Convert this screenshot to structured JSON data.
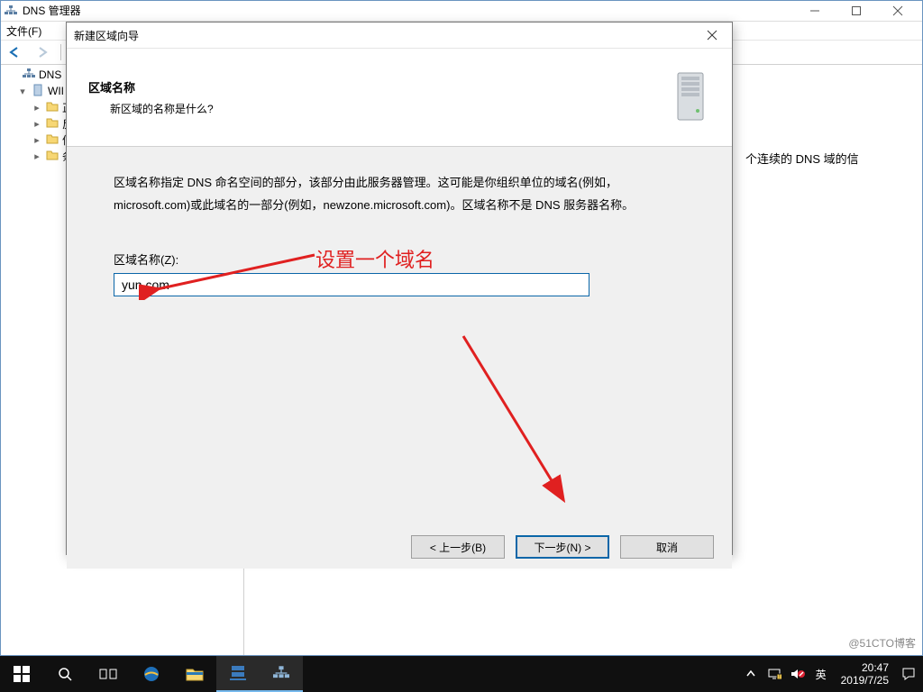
{
  "dns_window": {
    "title": "DNS 管理器",
    "menubar": {
      "file": "文件(F)"
    },
    "tree": {
      "root": "DNS",
      "server": "WII",
      "folders": [
        "正",
        "反",
        "信",
        "条"
      ]
    },
    "right_text": "个连续的 DNS 域的信"
  },
  "wizard": {
    "title": "新建区域向导",
    "header_title": "区域名称",
    "header_sub": "新区域的名称是什么?",
    "body_desc": "区域名称指定 DNS 命名空间的部分，该部分由此服务器管理。这可能是你组织单位的域名(例如，microsoft.com)或此域名的一部分(例如，newzone.microsoft.com)。区域名称不是 DNS 服务器名称。",
    "zone_label": "区域名称(Z):",
    "zone_value": "yun.com",
    "buttons": {
      "back": "< 上一步(B)",
      "next": "下一步(N) >",
      "cancel": "取消"
    }
  },
  "annotations": {
    "set_domain": "设置一个域名"
  },
  "taskbar": {
    "ime": "英",
    "clock_time": "20:47",
    "clock_date": "2019/7/25"
  },
  "watermark": "@51CTO博客"
}
